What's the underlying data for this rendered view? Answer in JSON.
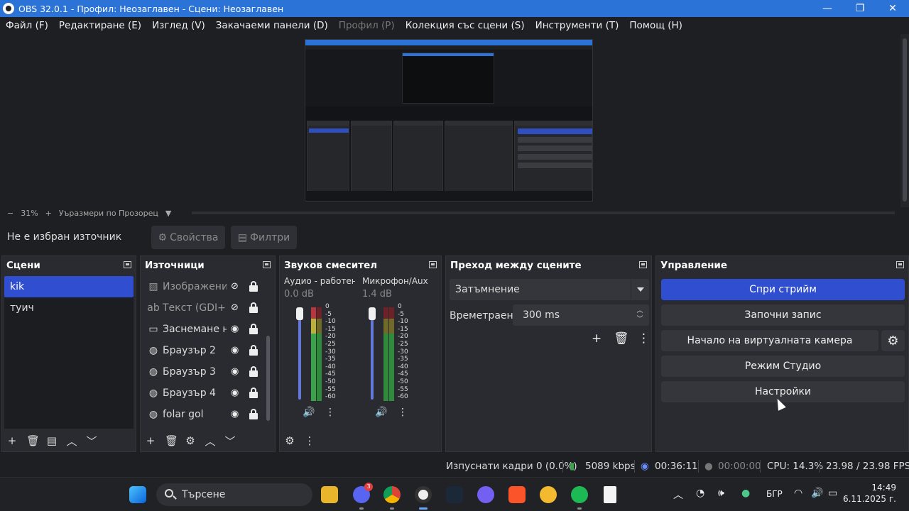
{
  "window": {
    "title": "OBS 32.0.1 - Профил: Неозаглавен - Сцени: Неозаглавен",
    "minimize": "—",
    "maximize": "❐",
    "close": "✕"
  },
  "menu": [
    {
      "label": "Файл (F)",
      "disabled": false
    },
    {
      "label": "Редактиране (E)",
      "disabled": false
    },
    {
      "label": "Изглед (V)",
      "disabled": false
    },
    {
      "label": "Закачаеми панели (D)",
      "disabled": false
    },
    {
      "label": "Профил (P)",
      "disabled": true
    },
    {
      "label": "Колекция със сцени (S)",
      "disabled": false
    },
    {
      "label": "Инструменти (T)",
      "disabled": false
    },
    {
      "label": "Помощ (H)",
      "disabled": false
    }
  ],
  "zoom": {
    "minus": "−",
    "percent": "31%",
    "plus": "+",
    "mode": "Уъразмери по Прозорец"
  },
  "source_bar": {
    "no_source": "Не е избран източник",
    "properties": "Свойства",
    "filters": "Филтри"
  },
  "scenes": {
    "title": "Сцени",
    "items": [
      {
        "label": "kik",
        "selected": true
      },
      {
        "label": "туич",
        "selected": false
      }
    ]
  },
  "sources": {
    "title": "Източници",
    "items": [
      {
        "label": "Изображение",
        "icon": "image-icon",
        "visible": false
      },
      {
        "label": "Текст (GDI+)",
        "icon": "text-icon",
        "visible": false
      },
      {
        "label": "Заснемане на",
        "icon": "monitor-icon",
        "visible": true
      },
      {
        "label": "Браузър 2",
        "icon": "globe-icon",
        "visible": true
      },
      {
        "label": "Браузър 3",
        "icon": "globe-icon",
        "visible": true
      },
      {
        "label": "Браузър 4",
        "icon": "globe-icon",
        "visible": true
      },
      {
        "label": "folar gol",
        "icon": "globe-icon",
        "visible": true
      }
    ]
  },
  "mixer": {
    "title": "Звуков смесител",
    "channels": [
      {
        "name": "Аудио - работен пл",
        "db": "0.0 dB",
        "volume": 1.0
      },
      {
        "name": "Микрофон/Aux",
        "db": "1.4 dB",
        "volume": 1.0
      }
    ],
    "scale": [
      "0",
      "-5",
      "-10",
      "-15",
      "-20",
      "-25",
      "-30",
      "-35",
      "-40",
      "-45",
      "-50",
      "-55",
      "-60"
    ]
  },
  "transitions": {
    "title": "Преход между сцените",
    "selected": "Затъмнение",
    "duration_label": "Времетраене",
    "duration_value": "300 ms"
  },
  "controls": {
    "title": "Управление",
    "stop_stream": "Спри стрийм",
    "start_record": "Започни запис",
    "start_vcam": "Начало на виртуалната камера",
    "studio_mode": "Режим Студио",
    "settings": "Настройки"
  },
  "status": {
    "dropped": "Изпуснати кадри 0 (0.0%)",
    "bitrate": "5089 kbps",
    "stream_time": "00:36:11",
    "record_time": "00:00:00",
    "cpu": "CPU: 14.3%",
    "fps": "23.98 / 23.98 FPS"
  },
  "taskbar": {
    "search_placeholder": "Търсене",
    "language": "БГР",
    "time": "14:49",
    "date": "6.11.2025 г.",
    "discord_badge": "3"
  },
  "colors": {
    "accent": "#2f4fd0",
    "titlebar": "#2b73d6",
    "panel": "#2a2b30",
    "meter_green": "#3aa34a",
    "meter_yellow": "#b9b13a",
    "meter_red": "#b8343f"
  }
}
